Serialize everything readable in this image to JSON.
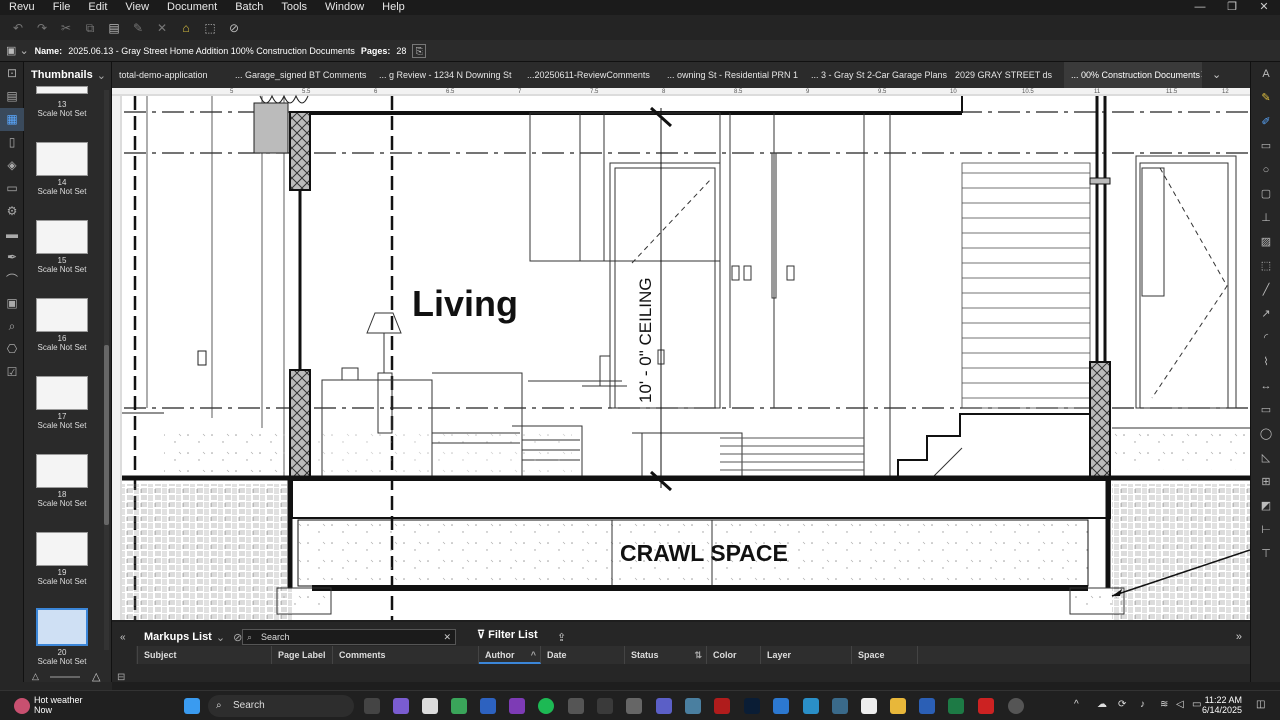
{
  "menubar": {
    "items": [
      "Revu",
      "File",
      "Edit",
      "View",
      "Document",
      "Batch",
      "Tools",
      "Window",
      "Help"
    ]
  },
  "window_controls": [
    "—",
    "❐",
    "✕"
  ],
  "docbar": {
    "name_label": "Name:",
    "name_value": "2025.06.13 - Gray Street Home Addition 100% Construction Documents",
    "pages_label": "Pages:",
    "pages_value": "28"
  },
  "thumbnails": {
    "title": "Thumbnails",
    "items": [
      {
        "page": "13",
        "scale": "Scale Not Set"
      },
      {
        "page": "14",
        "scale": "Scale Not Set"
      },
      {
        "page": "15",
        "scale": "Scale Not Set"
      },
      {
        "page": "16",
        "scale": "Scale Not Set"
      },
      {
        "page": "17",
        "scale": "Scale Not Set"
      },
      {
        "page": "18",
        "scale": "Scale Not Set"
      },
      {
        "page": "19",
        "scale": "Scale Not Set"
      },
      {
        "page": "20",
        "scale": "Scale Not Set",
        "selected": true
      }
    ]
  },
  "tabs": [
    {
      "label": "total-demo-application"
    },
    {
      "label": "... Garage_signed BT Comments"
    },
    {
      "label": "... g Review - 1234 N Downing St"
    },
    {
      "label": "...20250611-ReviewComments"
    },
    {
      "label": "... owning St - Residential PRN 1"
    },
    {
      "label": "... 3 - Gray St 2-Car Garage Plans"
    },
    {
      "label": "2029 GRAY STREET ds"
    },
    {
      "label": "... 00% Construction Documents",
      "active": true
    }
  ],
  "drawing": {
    "room_label": "Living",
    "ceiling_label": "10' - 0\" CEILING",
    "crawl_label": "CRAWL SPACE",
    "ruler_ticks": [
      "5",
      "5.5",
      "6",
      "6.5",
      "7",
      "7.5",
      "8",
      "8.5",
      "9",
      "9.5",
      "10",
      "10.5",
      "11",
      "11.5",
      "12"
    ]
  },
  "markups": {
    "title": "Markups List",
    "search_placeholder": "Search",
    "filter_label": "Filter List",
    "columns": [
      "Subject",
      "Page Label",
      "Comments",
      "Author",
      "Date",
      "Status",
      "Color",
      "Layer",
      "Space"
    ]
  },
  "taskbar": {
    "weather_title": "Hot weather",
    "weather_sub": "Now",
    "search_placeholder": "Search",
    "time": "11:22 AM",
    "date": "6/14/2025"
  },
  "colors": {
    "accent": "#3b86d8",
    "panel": "#2a2a2a",
    "chrome": "#1b1b1b"
  }
}
